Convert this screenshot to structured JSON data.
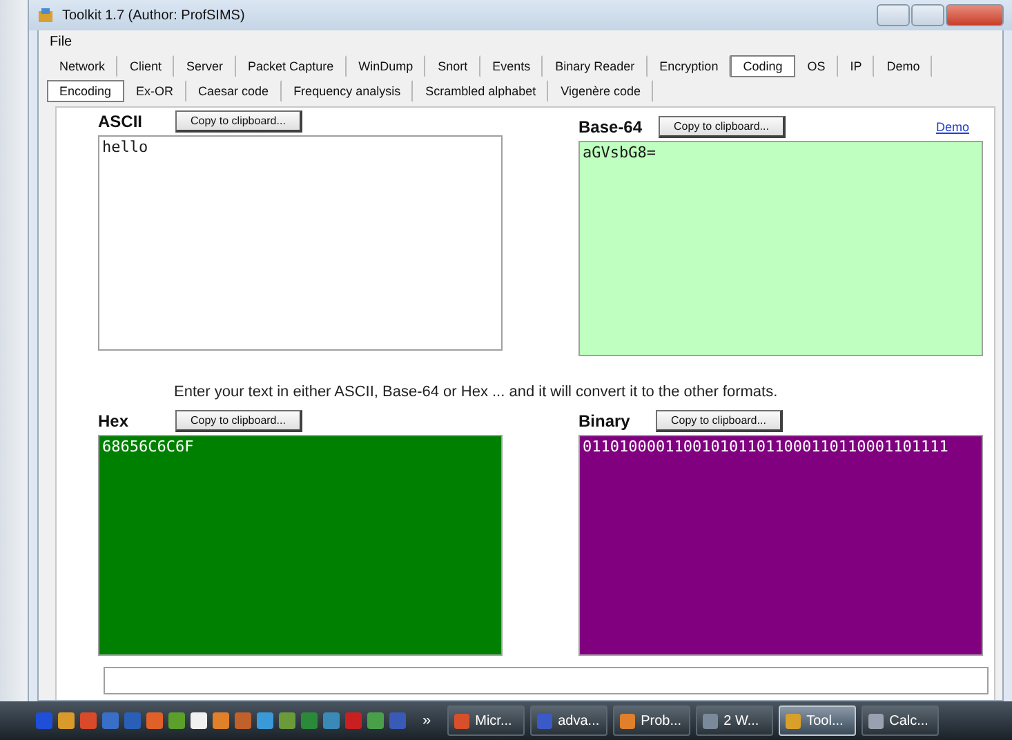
{
  "window": {
    "title": "Toolkit 1.7 (Author: ProfSIMS)"
  },
  "menu": [
    "File"
  ],
  "tabs": [
    {
      "label": "Network",
      "selected": false
    },
    {
      "label": "Client",
      "selected": false
    },
    {
      "label": "Server",
      "selected": false
    },
    {
      "label": "Packet Capture",
      "selected": false
    },
    {
      "label": "WinDump",
      "selected": false
    },
    {
      "label": "Snort",
      "selected": false
    },
    {
      "label": "Events",
      "selected": false
    },
    {
      "label": "Binary Reader",
      "selected": false
    },
    {
      "label": "Encryption",
      "selected": false
    },
    {
      "label": "Coding",
      "selected": true
    },
    {
      "label": "OS",
      "selected": false
    },
    {
      "label": "IP",
      "selected": false
    },
    {
      "label": "Demo",
      "selected": false
    }
  ],
  "subtabs": [
    {
      "label": "Encoding",
      "selected": true
    },
    {
      "label": "Ex-OR",
      "selected": false
    },
    {
      "label": "Caesar code",
      "selected": false
    },
    {
      "label": "Frequency analysis",
      "selected": false
    },
    {
      "label": "Scrambled alphabet",
      "selected": false
    },
    {
      "label": "Vigenère code",
      "selected": false
    }
  ],
  "demo_link": "Demo",
  "top_panels": [
    {
      "label": "ASCII",
      "button": "Copy to clipboard...",
      "value": "hello",
      "color": "#ffffff"
    },
    {
      "label": "Base-64",
      "button": "Copy to clipboard...",
      "value": "aGVsbG8=",
      "color": "#bfffbf"
    }
  ],
  "instruction": "Enter your text in either ASCII, Base-64 or Hex ... and it will convert it to the other formats.",
  "bottom_panels": [
    {
      "label": "Hex",
      "button": "Copy to clipboard...",
      "value": "68656C6C6F",
      "color": "#008000"
    },
    {
      "label": "Binary",
      "button": "Copy to clipboard...",
      "value": "0110100001100101011011000110110001101111",
      "color": "#800080"
    }
  ],
  "taskbar": {
    "overflow": "»",
    "tasks": [
      {
        "label": "Micr...",
        "selected": false
      },
      {
        "label": "adva...",
        "selected": false
      },
      {
        "label": "Prob...",
        "selected": false
      },
      {
        "label": "2 W...",
        "selected": false
      },
      {
        "label": "Tool...",
        "selected": true
      },
      {
        "label": "Calc...",
        "selected": false
      }
    ]
  }
}
